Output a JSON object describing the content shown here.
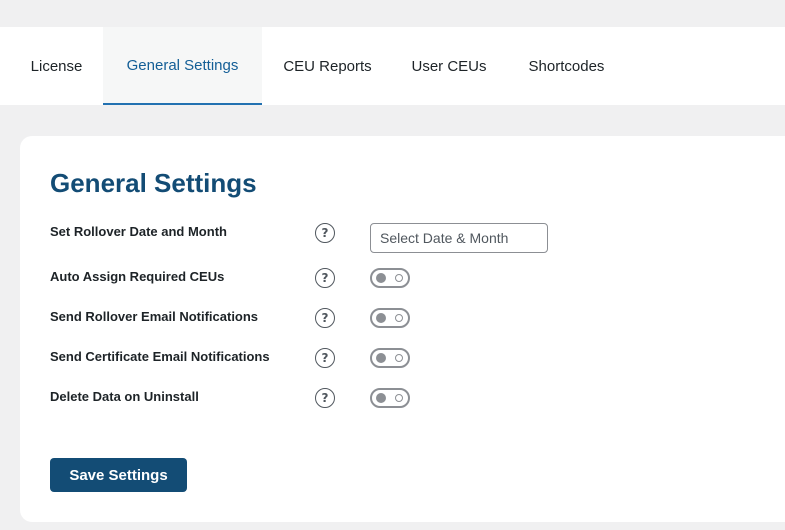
{
  "tabs": [
    {
      "label": "License",
      "active": false
    },
    {
      "label": "General Settings",
      "active": true
    },
    {
      "label": "CEU Reports",
      "active": false
    },
    {
      "label": "User CEUs",
      "active": false
    },
    {
      "label": "Shortcodes",
      "active": false
    }
  ],
  "settings": {
    "title": "General Settings",
    "rows": [
      {
        "label": "Set Rollover Date and Month",
        "help": "?",
        "control": "date-input",
        "placeholder": "Select Date & Month",
        "value": ""
      },
      {
        "label": "Auto Assign Required CEUs",
        "help": "?",
        "control": "toggle",
        "enabled": false
      },
      {
        "label": "Send Rollover Email Notifications",
        "help": "?",
        "control": "toggle",
        "enabled": false
      },
      {
        "label": "Send Certificate Email Notifications",
        "help": "?",
        "control": "toggle",
        "enabled": false
      },
      {
        "label": "Delete Data on Uninstall",
        "help": "?",
        "control": "toggle",
        "enabled": false
      }
    ],
    "save_label": "Save Settings"
  },
  "colors": {
    "accent": "#134c75",
    "tab_active": "#135e96",
    "page_bg": "#f0f0f1"
  },
  "icons": [
    "help-icon"
  ]
}
